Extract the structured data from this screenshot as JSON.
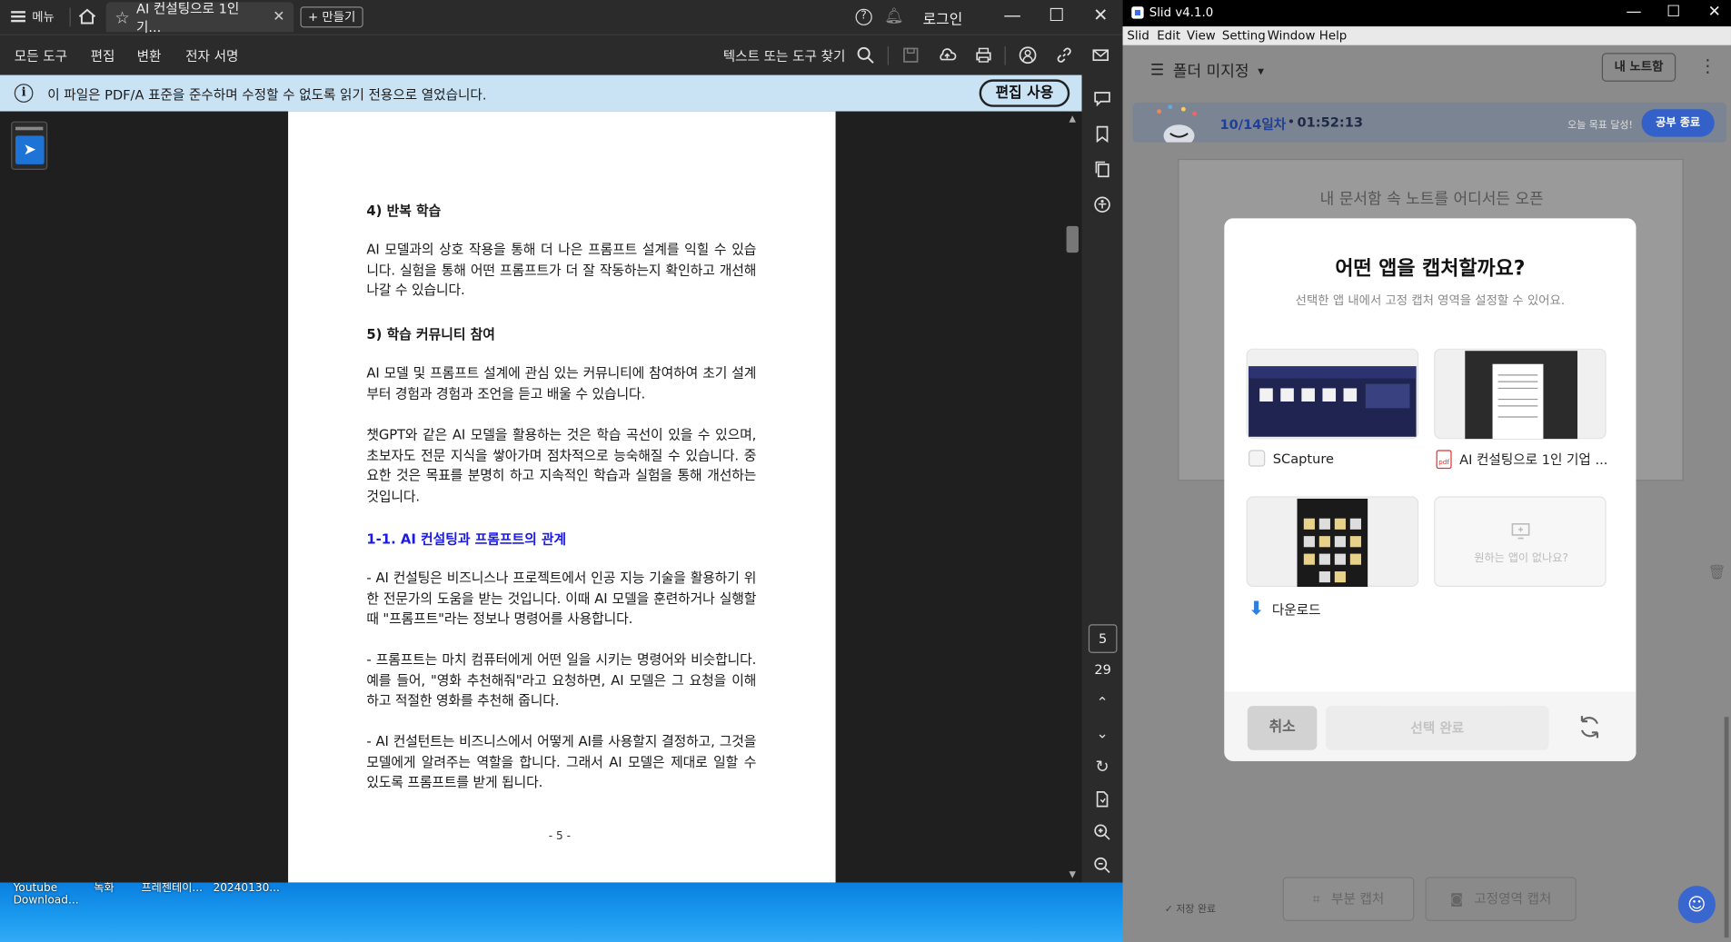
{
  "pdf_window": {
    "menu_label": "메뉴",
    "tab_title": "AI 컨설팅으로 1인 기...",
    "new_button": "+ 만들기",
    "login": "로그인",
    "toolbar": [
      "모든 도구",
      "편집",
      "변환",
      "전자 서명"
    ],
    "search_label": "텍스트 또는 도구 찾기",
    "info_text": "이 파일은 PDF/A 표준을 준수하며 수정할 수 없도록 읽기 전용으로 열었습니다.",
    "enable_edit": "편집 사용",
    "page_current": "5",
    "page_total": "29",
    "page_footer": "- 5 -",
    "content": {
      "h4": "4) 반복 학습",
      "p4": "AI 모델과의 상호 작용을 통해 더 나은 프롬프트 설계를 익힐 수 있습니다. 실험을 통해 어떤 프롬프트가 더 잘 작동하는지 확인하고 개선해 나갈 수 있습니다.",
      "h5": "5) 학습 커뮤니티 참여",
      "p5": "AI 모델 및 프롬프트 설계에 관심 있는 커뮤니티에 참여하여 초기 설계부터 경험과 경험과 조언을 듣고 배울 수 있습니다.",
      "p6": "챗GPT와 같은 AI 모델을 활용하는 것은 학습 곡선이 있을 수 있으며, 초보자도 전문 지식을 쌓아가며 점차적으로 능숙해질 수 있습니다. 중요한 것은 목표를 분명히 하고 지속적인 학습과 실험을 통해 개선하는 것입니다.",
      "section": "1-1. AI 컨설팅과 프롬프트의 관계",
      "b1": "- AI 컨설팅은 비즈니스나 프로젝트에서 인공 지능 기술을 활용하기 위한 전문가의 도움을 받는 것입니다. 이때 AI 모델을 훈련하거나 실행할 때 \"프롬프트\"라는 정보나 명령어를 사용합니다.",
      "b2": "- 프롬프트는 마치 컴퓨터에게 어떤 일을 시키는 명령어와 비슷합니다. 예를 들어, \"영화 추천해줘\"라고 요청하면, AI 모델은 그 요청을 이해하고 적절한 영화를 추천해 줍니다.",
      "b3": "- AI 컨설턴트는 비즈니스에서 어떻게 AI를 사용할지 결정하고, 그것을 모델에게 알려주는 역할을 합니다. 그래서 AI 모델은 제대로 일할 수 있도록 프롬프트를 받게 됩니다."
    }
  },
  "desktop": {
    "icons": [
      "Youtube Download...",
      "녹화",
      "프레젠테이...",
      "20240130..."
    ]
  },
  "slid": {
    "title": "Slid v4.1.0",
    "menu": [
      "Slid",
      "Edit",
      "View",
      "Setting",
      "Window",
      "Help"
    ],
    "folder": "폴더 미지정",
    "notebook_button": "내 노트함",
    "banner_date": "10/14일차",
    "banner_time": "01:52:13",
    "banner_goal": "오늘 목표 달성!",
    "banner_end": "공부 종료",
    "card_hint": "내 문서함 속 노트를 어디서든 오픈",
    "partial_capture": "부분 캡처",
    "fixed_capture": "고정영역 캡처",
    "saved": "✓ 저장 완료",
    "modal": {
      "title": "어떤 앱을 캡처할까요?",
      "subtitle": "선택한 앱 내에서 고정 캡처 영역을 설정할 수 있어요.",
      "apps": [
        {
          "label": "SCapture"
        },
        {
          "label": "AI 컨설팅으로 1인 기업 ..."
        },
        {
          "label": "다운로드"
        },
        {
          "label": "원하는 앱이 없나요?"
        }
      ],
      "cancel": "취소",
      "done": "선택 완료"
    }
  }
}
